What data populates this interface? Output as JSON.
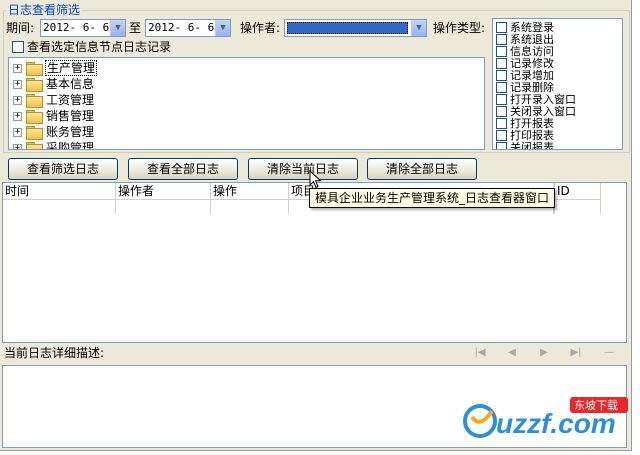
{
  "filter": {
    "group_title": "日志查看筛选",
    "period_label": "期间:",
    "date_from": "2012- 6- 6",
    "to_label": "至",
    "date_to": "2012- 6- 6",
    "operator_label": "操作者:",
    "operator_value": "",
    "optype_label": "操作类型:",
    "checkbox_node_label": "查看选定信息节点日志记录"
  },
  "tree": {
    "items": [
      {
        "label": "生产管理"
      },
      {
        "label": "基本信息"
      },
      {
        "label": "工资管理"
      },
      {
        "label": "销售管理"
      },
      {
        "label": "账务管理"
      },
      {
        "label": "采购管理"
      }
    ]
  },
  "operation_types": [
    {
      "label": "系统登录"
    },
    {
      "label": "系统退出"
    },
    {
      "label": "信息访问"
    },
    {
      "label": "记录修改"
    },
    {
      "label": "记录增加"
    },
    {
      "label": "记录删除"
    },
    {
      "label": "打开录入窗口"
    },
    {
      "label": "关闭录入窗口"
    },
    {
      "label": "打开报表"
    },
    {
      "label": "打印报表"
    },
    {
      "label": "关闭报表"
    }
  ],
  "buttons": {
    "view_filtered": "查看筛选日志",
    "view_all": "查看全部日志",
    "clear_current": "清除当前日志",
    "clear_all": "清除全部日志"
  },
  "grid": {
    "columns": [
      "时间",
      "操作者",
      "操作",
      "项目",
      "",
      "ID"
    ]
  },
  "detail": {
    "label": "当前日志详细描述:"
  },
  "tooltip": "模具企业业务生产管理系统_日志查看器窗口",
  "watermark": {
    "brand": "uzzf.com",
    "tag": "东坡下载"
  }
}
